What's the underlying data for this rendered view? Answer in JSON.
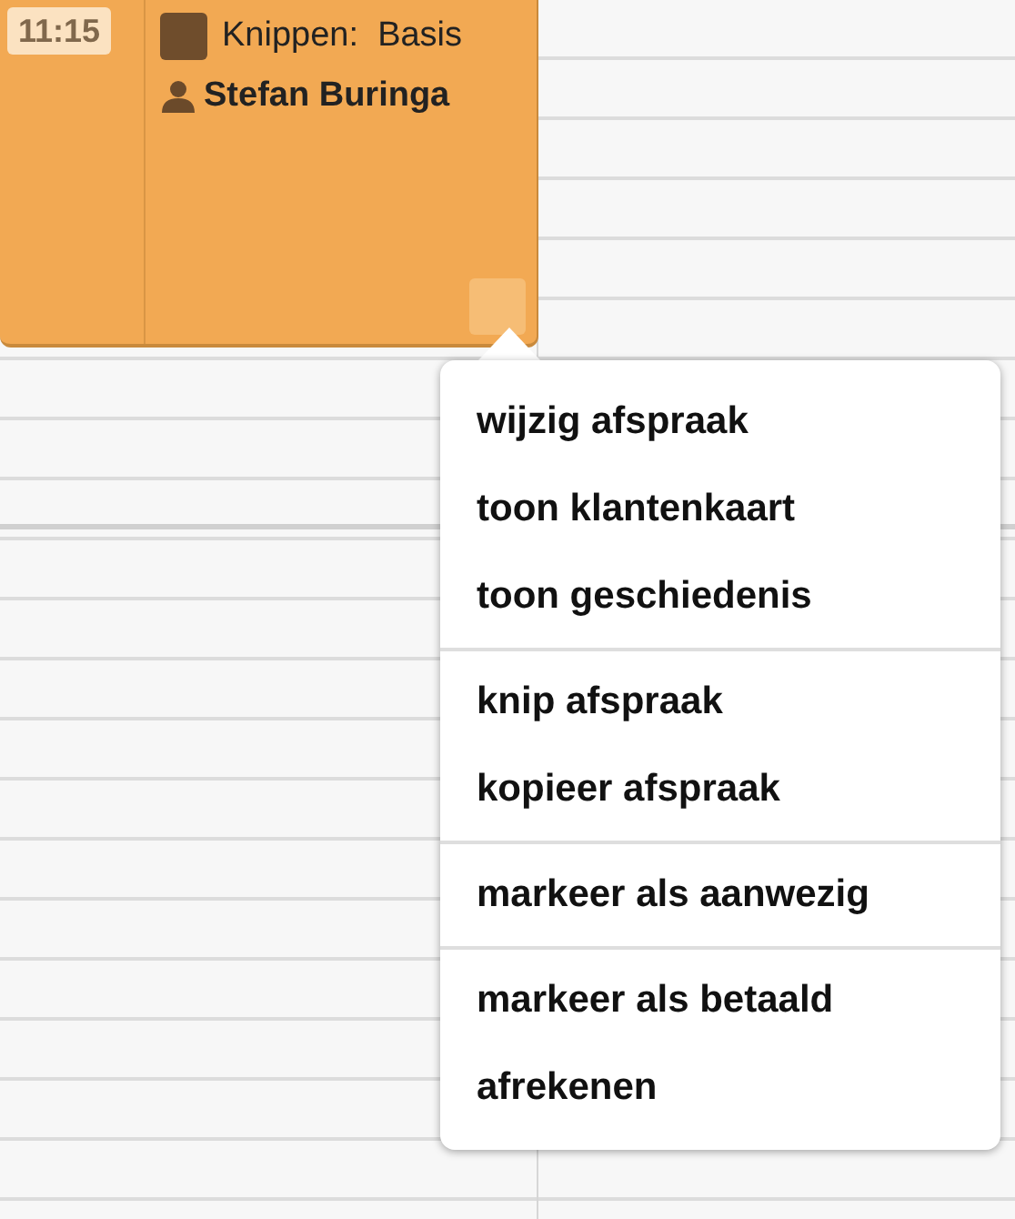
{
  "appointment": {
    "time": "11:15",
    "color": "#6f4d2c",
    "title": "Knippen:  Basis",
    "client": "Stefan Buringa"
  },
  "context_menu": {
    "groups": [
      {
        "items": [
          "wijzig afspraak",
          "toon klantenkaart",
          "toon geschiedenis"
        ]
      },
      {
        "items": [
          "knip afspraak",
          "kopieer afspraak"
        ]
      },
      {
        "items": [
          "markeer als aanwezig"
        ]
      },
      {
        "items": [
          "markeer als betaald",
          "afrekenen"
        ]
      }
    ]
  }
}
